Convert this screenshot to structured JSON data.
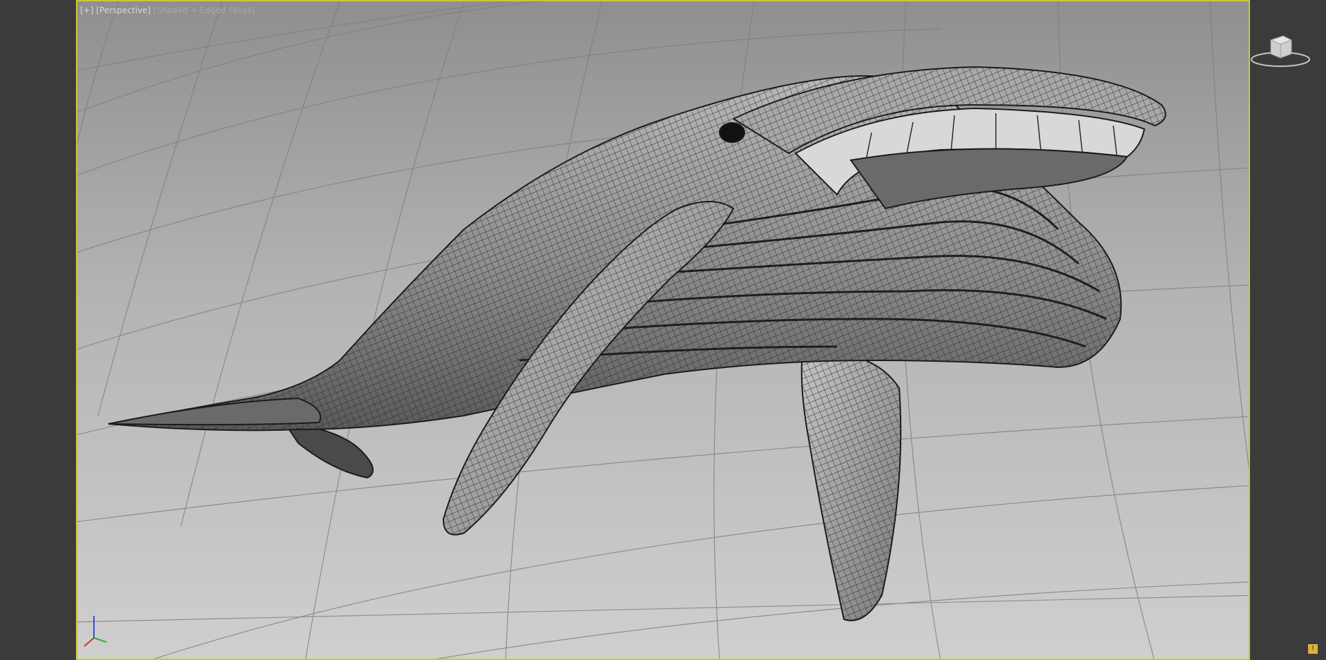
{
  "viewport": {
    "menu_label": "[+]",
    "view_label": "[Perspective]",
    "shading_label": "[Shaded + Edged Faces]",
    "border_color": "#c8c83c"
  },
  "viewcube": {
    "icon": "viewcube-icon"
  },
  "axis_tripod": {
    "icon": "axis-tripod-icon",
    "x_color": "#d03030",
    "y_color": "#30b030",
    "z_color": "#3050d0"
  },
  "scene": {
    "object": "humpback-whale-mesh",
    "icon": "whale-model"
  },
  "status": {
    "icon": "status-warning-icon",
    "label": "!"
  }
}
